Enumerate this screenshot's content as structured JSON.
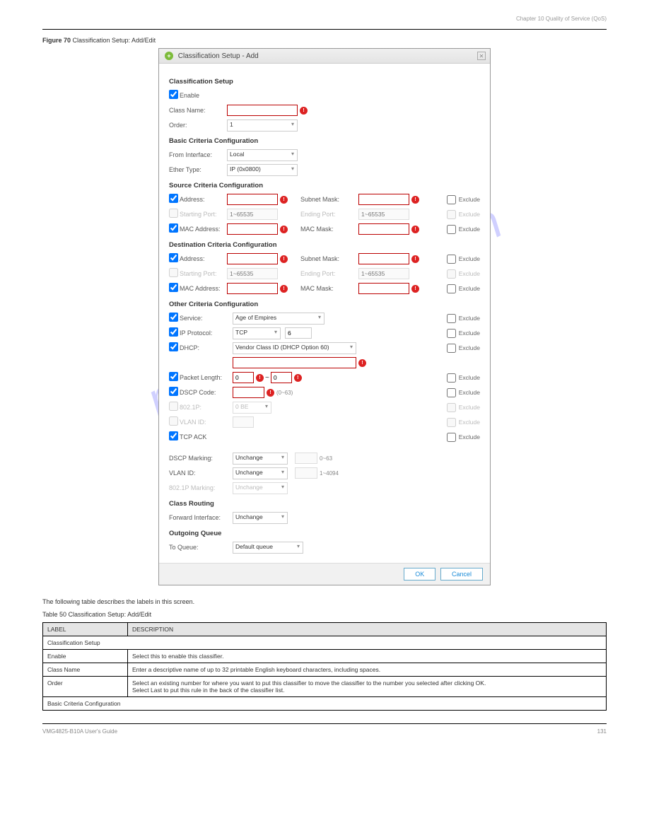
{
  "header": {
    "chapter": "Chapter 10 Quality of Service (QoS)"
  },
  "figure": {
    "prefix": "Figure 70   ",
    "title": "Classification Setup: Add/Edit"
  },
  "dialog": {
    "title": "Classification Setup - Add",
    "sections": {
      "setup": {
        "title": "Classification Setup",
        "enable": "Enable",
        "className": "Class Name:",
        "order": "Order:",
        "orderValue": "1"
      },
      "basic": {
        "title": "Basic Criteria Configuration",
        "fromInterface": "From Interface:",
        "fromInterfaceValue": "Local",
        "etherType": "Ether Type:",
        "etherTypeValue": "IP (0x0800)"
      },
      "source": {
        "title": "Source Criteria Configuration",
        "address": "Address:",
        "subnet": "Subnet Mask:",
        "startPort": "Starting Port:",
        "endPort": "Ending Port:",
        "ph": "1~65535",
        "mac": "MAC Address:",
        "macMask": "MAC Mask:"
      },
      "dest": {
        "title": "Destination Criteria Configuration"
      },
      "other": {
        "title": "Other Criteria Configuration",
        "service": "Service:",
        "serviceValue": "Age of Empires",
        "ipProto": "IP Protocol:",
        "ipProtoValue": "TCP",
        "ipProtoNum": "6",
        "dhcp": "DHCP:",
        "dhcpValue": "Vendor Class ID (DHCP Option 60)",
        "pktLen": "Packet Length:",
        "pktLenV1": "0",
        "pktLenV2": "0",
        "dscpCode": "DSCP Code:",
        "dscpHint": "(0~63)",
        "p8021": "802.1P:",
        "p8021Value": "0 BE",
        "vlanId": "VLAN ID:",
        "tcpAck": "TCP ACK"
      },
      "marking": {
        "dscp": "DSCP Marking:",
        "unchange": "Unchange",
        "vlan": "VLAN ID:",
        "p8021": "802.1P Marking:",
        "dscpPh": "0~63",
        "vlanPh": "1~4094"
      },
      "routing": {
        "title": "Class Routing",
        "fwd": "Forward Interface:",
        "fwdValue": "Unchange"
      },
      "queue": {
        "title": "Outgoing Queue",
        "toQueue": "To Queue:",
        "toQueueValue": "Default queue"
      }
    },
    "exclude": "Exclude",
    "ok": "OK",
    "cancel": "Cancel"
  },
  "description": "The following table describes the labels in this screen.",
  "tableLabel": "Table 50   Classification Setup: Add/Edit",
  "table": {
    "h1": "LABEL",
    "h2": "DESCRIPTION",
    "rows": [
      {
        "label": "Classification Setup",
        "desc": "",
        "section": true
      },
      {
        "label": "Enable",
        "desc": "Select this to enable this classifier."
      },
      {
        "label": "Class Name",
        "desc": "Enter a descriptive name of up to 32 printable English keyboard characters, including spaces."
      },
      {
        "label": "Order",
        "desc": "Select an existing number for where you want to put this classifier to move the classifier to the number you selected after clicking OK.\nSelect Last to put this rule in the back of the classifier list."
      },
      {
        "label": "Basic Criteria Configuration",
        "desc": "",
        "section": true
      }
    ]
  },
  "footer": {
    "left": "VMG4825-B10A User's Guide",
    "right": "131"
  },
  "watermark": "manualshive.com"
}
